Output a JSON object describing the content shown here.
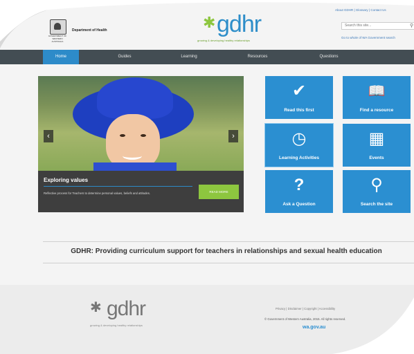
{
  "header": {
    "crest_text": "GOVERNMENT OF WESTERN AUSTRALIA",
    "department": "Department of Health",
    "logo_word": "gdhr",
    "logo_tagline": "growing & developing healthy relationships",
    "top_links": "About GDHR | Glossary | Contact Us",
    "search_placeholder": "Search this site...",
    "goto_link": "Go to whole of WA Government search"
  },
  "nav": {
    "items": [
      "Home",
      "Guides",
      "Learning",
      "Resources",
      "Questions"
    ]
  },
  "slider": {
    "title": "Exploring values",
    "description": "Reflective process for Teachers to determine personal values, beliefs and attitudes.",
    "read_more": "READ MORE",
    "prev": "‹",
    "next": "›"
  },
  "tiles": [
    {
      "label": "Read this first",
      "icon": "check-icon",
      "glyph": "✔"
    },
    {
      "label": "Find a resource",
      "icon": "book-icon",
      "glyph": "📖"
    },
    {
      "label": "Learning Activities",
      "icon": "clock-icon",
      "glyph": "◷"
    },
    {
      "label": "Events",
      "icon": "calendar-icon",
      "glyph": "▦"
    },
    {
      "label": "Ask a Question",
      "icon": "question-icon",
      "glyph": "?"
    },
    {
      "label": "Search the site",
      "icon": "search-icon",
      "glyph": "⚲"
    }
  ],
  "tagline": "GDHR: Providing curriculum support for teachers in relationships and sexual health education",
  "footer": {
    "logo_word": "gdhr",
    "logo_tagline": "growing & developing healthy relationships",
    "links": "Privacy | Disclaimer | Copyright | Accessibility",
    "copyright": "© Government of Western Australia, 2015. All rights reserved.",
    "wa_link": "wa.gov.au"
  },
  "colors": {
    "brand_blue": "#2b8fd1",
    "nav_bg": "#434d53",
    "accent_green": "#8dc63f"
  }
}
